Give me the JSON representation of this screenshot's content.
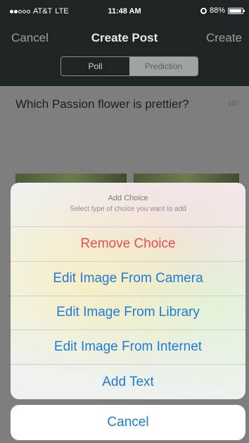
{
  "status_bar": {
    "carrier": "AT&T",
    "network": "LTE",
    "time": "11:48 AM",
    "battery": "88%"
  },
  "nav": {
    "left": "Cancel",
    "title": "Create Post",
    "right": "Create"
  },
  "segments": [
    {
      "label": "Poll",
      "selected": false
    },
    {
      "label": "Prediction",
      "selected": true
    }
  ],
  "post": {
    "question": "Which Passion flower is prettier?",
    "char_count": "107"
  },
  "action_sheet": {
    "title": "Add Choice",
    "subtitle": "Select type of choice you want to add",
    "options": [
      "Remove Choice",
      "Edit Image From Camera",
      "Edit Image From Library",
      "Edit Image From Internet",
      "Add Text"
    ],
    "cancel": "Cancel"
  },
  "colors": {
    "nav_bg": "#1f2426",
    "action_blue": "#1f7cd6",
    "destructive_red": "#e94e4e"
  }
}
